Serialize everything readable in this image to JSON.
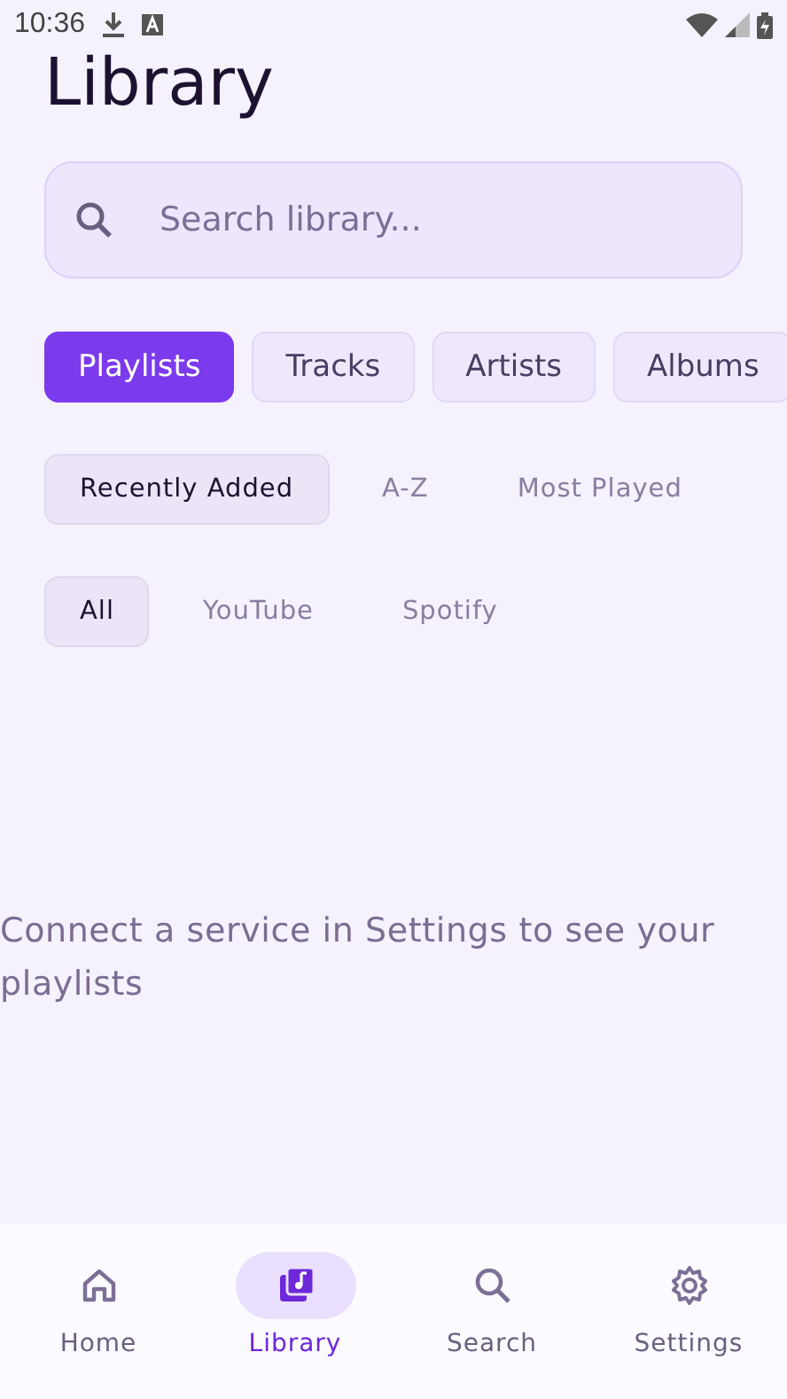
{
  "status_bar": {
    "time": "10:36"
  },
  "title": "Library",
  "search": {
    "placeholder": "Search library..."
  },
  "tabs": [
    {
      "label": "Playlists",
      "selected": true
    },
    {
      "label": "Tracks",
      "selected": false
    },
    {
      "label": "Artists",
      "selected": false
    },
    {
      "label": "Albums",
      "selected": false
    }
  ],
  "sort_options": [
    {
      "label": "Recently Added",
      "selected": true
    },
    {
      "label": "A-Z",
      "selected": false
    },
    {
      "label": "Most Played",
      "selected": false
    }
  ],
  "sources": [
    {
      "label": "All",
      "selected": true
    },
    {
      "label": "YouTube",
      "selected": false
    },
    {
      "label": "Spotify",
      "selected": false
    }
  ],
  "empty_message": "Connect a service in Settings to see your playlists",
  "bottom_nav": [
    {
      "kind": "home",
      "label": "Home",
      "selected": false
    },
    {
      "kind": "library",
      "label": "Library",
      "selected": true
    },
    {
      "kind": "search",
      "label": "Search",
      "selected": false
    },
    {
      "kind": "settings",
      "label": "Settings",
      "selected": false
    }
  ]
}
